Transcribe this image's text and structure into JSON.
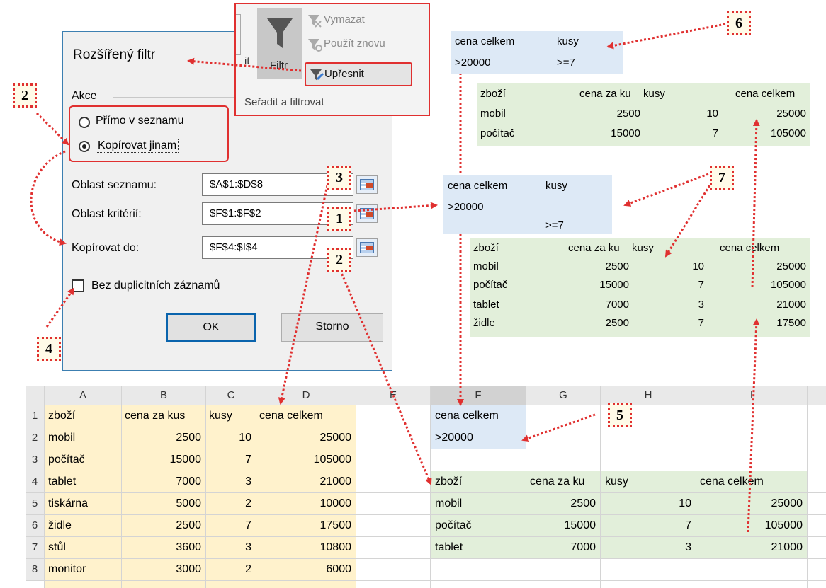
{
  "dialog": {
    "title": "Rozšířený filtr",
    "akce_label": "Akce",
    "radio_in_place": "Přímo v seznamu",
    "radio_copy": "Kopírovat jinam",
    "list_range_label": "Oblast seznamu:",
    "list_range_value": "$A$1:$D$8",
    "criteria_range_label": "Oblast kritérií:",
    "criteria_range_value": "$F$1:$F$2",
    "copy_to_label": "Kopírovat do:",
    "copy_to_value": "$F$4:$I$4",
    "unique_label": "Bez duplicitních záznamů",
    "ok": "OK",
    "cancel": "Storno"
  },
  "ribbon": {
    "filter_label": "Filtr",
    "clear_label": "Vymazat",
    "reapply_label": "Použít znovu",
    "advanced_label": "Upřesnit",
    "group_label": "Seřadit a filtrovat",
    "partial_label": "it"
  },
  "badges": [
    "1",
    "2",
    "2",
    "3",
    "4",
    "5",
    "6",
    "7"
  ],
  "crit6": {
    "h1": "cena celkem",
    "h2": "kusy",
    "v1": ">20000",
    "v2": ">=7"
  },
  "res6": {
    "headers": [
      "zboží",
      "cena za ku",
      "kusy",
      "cena celkem"
    ],
    "rows": [
      [
        "mobil",
        "2500",
        "10",
        "25000"
      ],
      [
        "počítač",
        "15000",
        "7",
        "105000"
      ]
    ]
  },
  "crit7": {
    "h1": "cena celkem",
    "h2": "kusy",
    "v1": ">20000",
    "v2": ">=7"
  },
  "res7": {
    "headers": [
      "zboží",
      "cena za ku",
      "kusy",
      "cena celkem"
    ],
    "rows": [
      [
        "mobil",
        "2500",
        "10",
        "25000"
      ],
      [
        "počítač",
        "15000",
        "7",
        "105000"
      ],
      [
        "tablet",
        "7000",
        "3",
        "21000"
      ],
      [
        "židle",
        "2500",
        "7",
        "17500"
      ]
    ]
  },
  "sheet": {
    "columns": [
      "A",
      "B",
      "C",
      "D",
      "E",
      "F",
      "G",
      "H",
      "I"
    ],
    "row_numbers": [
      "1",
      "2",
      "3",
      "4",
      "5",
      "6",
      "7",
      "8"
    ],
    "data": {
      "headers": [
        "zboží",
        "cena za kus",
        "kusy",
        "cena celkem"
      ],
      "rows": [
        [
          "mobil",
          "2500",
          "10",
          "25000"
        ],
        [
          "počítač",
          "15000",
          "7",
          "105000"
        ],
        [
          "tablet",
          "7000",
          "3",
          "21000"
        ],
        [
          "tiskárna",
          "5000",
          "2",
          "10000"
        ],
        [
          "židle",
          "2500",
          "7",
          "17500"
        ],
        [
          "stůl",
          "3600",
          "3",
          "10800"
        ],
        [
          "monitor",
          "3000",
          "2",
          "6000"
        ]
      ]
    },
    "criteria": {
      "header": "cena celkem",
      "value": ">20000"
    },
    "output": {
      "headers": [
        "zboží",
        "cena za ku",
        "kusy",
        "cena celkem"
      ],
      "rows": [
        [
          "mobil",
          "2500",
          "10",
          "25000"
        ],
        [
          "počítač",
          "15000",
          "7",
          "105000"
        ],
        [
          "tablet",
          "7000",
          "3",
          "21000"
        ]
      ]
    }
  }
}
